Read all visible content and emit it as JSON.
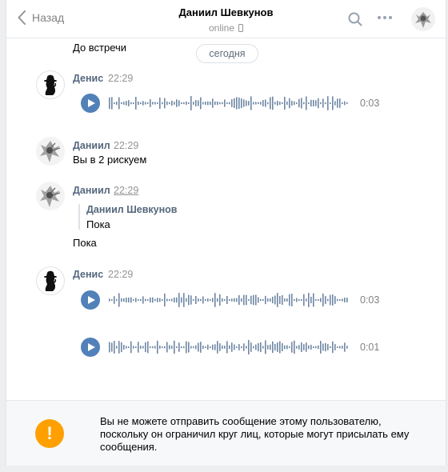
{
  "header": {
    "back_label": "Назад",
    "title": "Даниил Шевкунов",
    "status": "online"
  },
  "first_message": "До встречи",
  "date_divider": "сегодня",
  "messages": [
    {
      "name": "Денис",
      "time": "22:29",
      "voice_duration": "0:03"
    },
    {
      "name": "Даниил",
      "time": "22:29",
      "text": "Вы в 2 рискуем"
    },
    {
      "name": "Даниил",
      "time": "22:29",
      "quote_name": "Даниил Шевкунов",
      "quote_text": "Пока",
      "text": "Пока"
    },
    {
      "name": "Денис",
      "time": "22:29",
      "voice_duration": "0:03",
      "voice2_duration": "0:01"
    }
  ],
  "footer": {
    "notice": "Вы не можете отправить сообщение этому пользователю, поскольку он ограничил круг лиц, которые могут присылать ему сообщения.",
    "icon_glyph": "!"
  },
  "colors": {
    "accent": "#5181b8",
    "name": "#55677d",
    "warning": "#ffa000"
  }
}
